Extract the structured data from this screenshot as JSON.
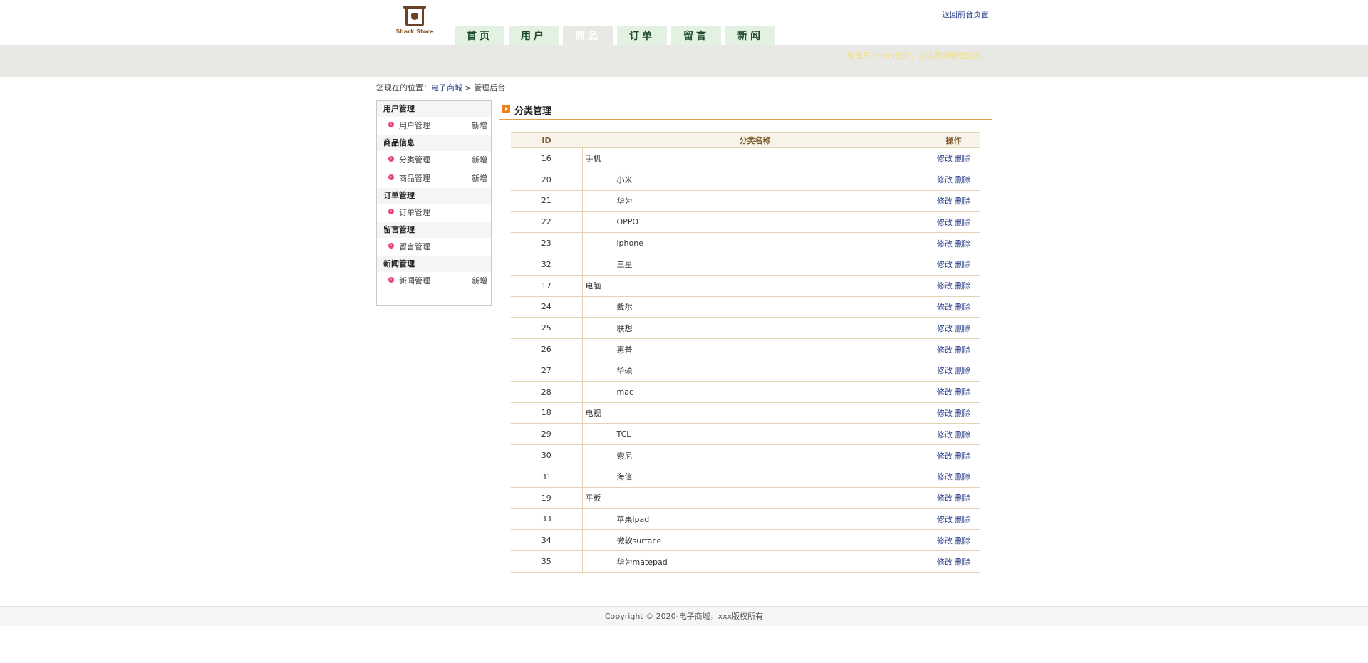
{
  "brand": {
    "logo_text": "Shark Store",
    "back_link": "返回前台页面"
  },
  "nav": {
    "tabs": [
      "首页",
      "用户",
      "商品",
      "订单",
      "留言",
      "新闻"
    ],
    "active_index": 2
  },
  "welcome_text": "管理员admin您好，欢迎回到管理后台。",
  "breadcrumb": {
    "prefix": "您现在的位置：",
    "home": "电子商城",
    "sep": " > ",
    "current": "管理后台"
  },
  "sidebar": {
    "groups": [
      {
        "title": "用户管理",
        "items": [
          {
            "label": "用户管理",
            "add": "新增"
          }
        ]
      },
      {
        "title": "商品信息",
        "items": [
          {
            "label": "分类管理",
            "add": "新增"
          },
          {
            "label": "商品管理",
            "add": "新增"
          }
        ]
      },
      {
        "title": "订单管理",
        "items": [
          {
            "label": "订单管理",
            "add": ""
          }
        ]
      },
      {
        "title": "留言管理",
        "items": [
          {
            "label": "留言管理",
            "add": ""
          }
        ]
      },
      {
        "title": "新闻管理",
        "items": [
          {
            "label": "新闻管理",
            "add": "新增"
          }
        ]
      }
    ]
  },
  "main": {
    "title": "分类管理",
    "columns": [
      "ID",
      "分类名称",
      "操作"
    ],
    "edit_label": "修改",
    "delete_label": "删除",
    "rows": [
      {
        "id": "16",
        "name": "手机",
        "level": 0
      },
      {
        "id": "20",
        "name": "小米",
        "level": 1
      },
      {
        "id": "21",
        "name": "华为",
        "level": 1
      },
      {
        "id": "22",
        "name": "OPPO",
        "level": 1
      },
      {
        "id": "23",
        "name": "iphone",
        "level": 1
      },
      {
        "id": "32",
        "name": "三星",
        "level": 1
      },
      {
        "id": "17",
        "name": "电脑",
        "level": 0
      },
      {
        "id": "24",
        "name": "戴尔",
        "level": 1
      },
      {
        "id": "25",
        "name": "联想",
        "level": 1
      },
      {
        "id": "26",
        "name": "惠普",
        "level": 1
      },
      {
        "id": "27",
        "name": "华硕",
        "level": 1
      },
      {
        "id": "28",
        "name": "mac",
        "level": 1
      },
      {
        "id": "18",
        "name": "电视",
        "level": 0
      },
      {
        "id": "29",
        "name": "TCL",
        "level": 1
      },
      {
        "id": "30",
        "name": "索尼",
        "level": 1
      },
      {
        "id": "31",
        "name": "海信",
        "level": 1
      },
      {
        "id": "19",
        "name": "平板",
        "level": 0
      },
      {
        "id": "33",
        "name": "苹果ipad",
        "level": 1
      },
      {
        "id": "34",
        "name": "微软surface",
        "level": 1
      },
      {
        "id": "35",
        "name": "华为matepad",
        "level": 1
      }
    ]
  },
  "footer": {
    "copyright": "Copyright © 2020-电子商城，xxx版权所有"
  }
}
